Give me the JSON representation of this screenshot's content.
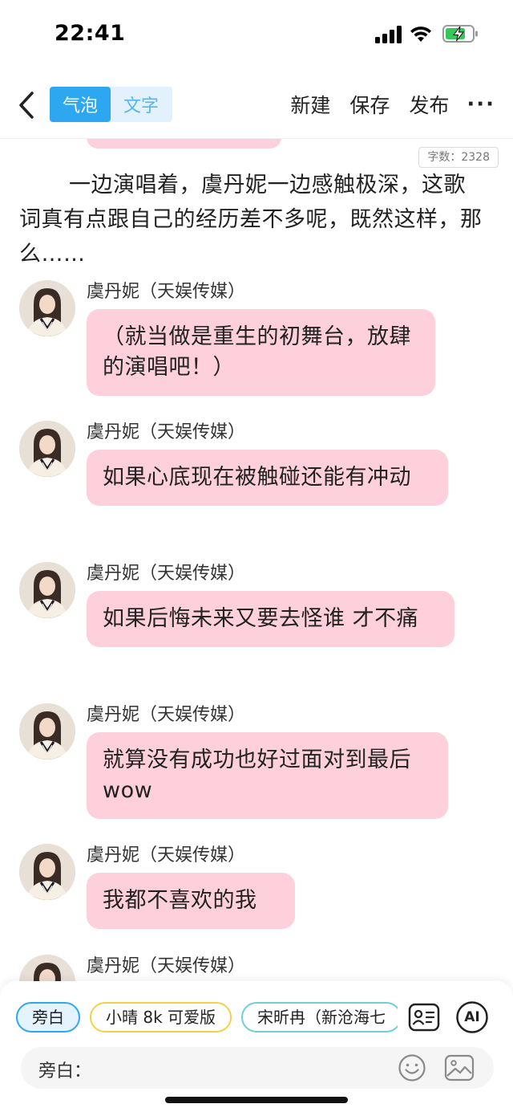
{
  "status_bar": {
    "time": "22:41"
  },
  "nav": {
    "toggle": [
      {
        "label": "气泡",
        "active": true
      },
      {
        "label": "文字",
        "active": false
      }
    ],
    "actions": [
      "新建",
      "保存",
      "发布"
    ],
    "more_label": "···"
  },
  "content": {
    "word_count": "字数：2328",
    "narration": "一边演唱着，虞丹妮一边感触极深，这歌词真有点跟自己的经历差不多呢，既然这样，那么……",
    "messages": [
      {
        "name": "虞丹妮（天娱传媒）",
        "text": "（就当做是重生的初舞台，放肆的演唱吧！）"
      },
      {
        "name": "虞丹妮（天娱传媒）",
        "text": "如果心底现在被触碰还能有冲动"
      },
      {
        "name": "虞丹妮（天娱传媒）",
        "text": "如果后悔未来又要去怪谁 才不痛"
      },
      {
        "name": "虞丹妮（天娱传媒）",
        "text": "就算没有成功也好过面对到最后 wow"
      },
      {
        "name": "虞丹妮（天娱传媒）",
        "text": "我都不喜欢的我"
      },
      {
        "name": "虞丹妮（天娱传媒）",
        "text": ""
      }
    ]
  },
  "bottom": {
    "chips": [
      "旁白",
      "小晴 8k 可爱版",
      "宋昕冉（新沧海七"
    ],
    "ai_label": "AI",
    "input_label": "旁白：",
    "input_value": ""
  },
  "colors": {
    "accent": "#2da8f0",
    "bubble": "#fdd0dc",
    "chip_yellow": "#f3d04a",
    "chip_teal": "#6fcfd2"
  },
  "icons": [
    "signal-icon",
    "wifi-icon",
    "battery-charging-icon",
    "back-chevron-icon",
    "more-icon",
    "contacts-card-icon",
    "ai-icon",
    "emoji-icon",
    "image-icon"
  ]
}
